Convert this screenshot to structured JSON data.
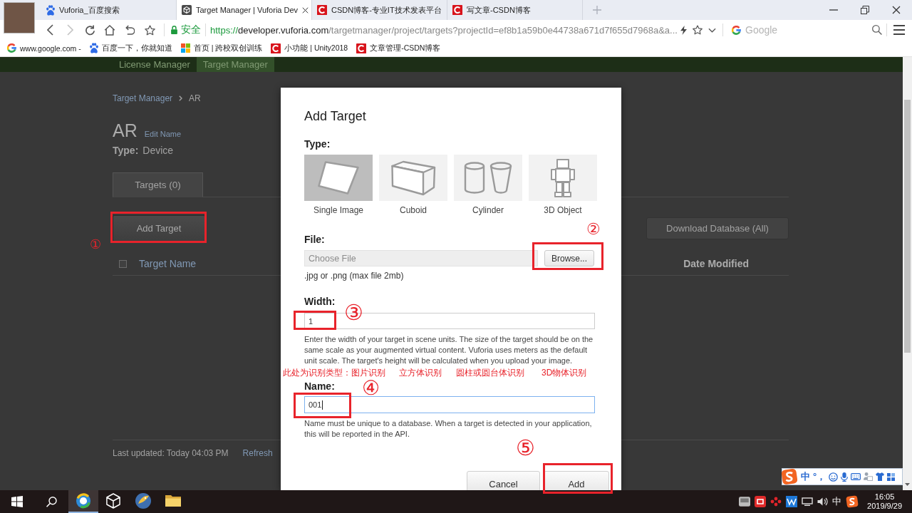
{
  "browser": {
    "tabs": [
      {
        "title": "Vuforia_百度搜索",
        "kind": "paw",
        "selected": false
      },
      {
        "title": "Target Manager | Vuforia Dev",
        "kind": "cube",
        "selected": true
      },
      {
        "title": "CSDN博客-专业IT技术发表平台",
        "kind": "letter-c",
        "selected": false
      },
      {
        "title": "写文章-CSDN博客",
        "kind": "letter-c",
        "selected": false
      }
    ],
    "forward_disabled": true,
    "address": {
      "secure_label": "安全",
      "url_scheme": "https://",
      "url_host": "developer.vuforia.com",
      "url_rest": "/targetmanager/project/targets?projectId=ef8b1a59b0e44738a671d7f655d7968a&a...",
      "search_placeholder": "Google"
    },
    "bookmarks": [
      {
        "label": "www.google.com -",
        "kind": "g"
      },
      {
        "label": "百度一下，你就知道",
        "kind": "paw"
      },
      {
        "label": "首页 | 跨校双创训练",
        "kind": "squares"
      },
      {
        "label": "小功能 | Unity2018",
        "kind": "letter-c"
      },
      {
        "label": "文章管理-CSDN博客",
        "kind": "letter-c"
      }
    ]
  },
  "page": {
    "nav": [
      {
        "label": "License Manager",
        "selected": false
      },
      {
        "label": "Target Manager",
        "selected": true
      }
    ],
    "breadcrumb": [
      "Target Manager",
      "AR"
    ],
    "title": "AR",
    "edit_link": "Edit Name",
    "type_label": "Type:",
    "type_value": "Device",
    "tabs": [
      {
        "label": "Targets (0)",
        "selected": true
      }
    ],
    "add_button": "Add Target",
    "download_button": "Download Database (All)",
    "select_all": {
      "checked": false
    },
    "columns": [
      "Target Name",
      "Date Modified"
    ],
    "last_updated": "Last updated: Today 04:03 PM",
    "refresh_link": "Refresh"
  },
  "dialog": {
    "title": "Add Target",
    "type_label": "Type:",
    "types": [
      {
        "label": "Single Image",
        "kind": "image",
        "selected": true
      },
      {
        "label": "Cuboid",
        "kind": "cuboid",
        "selected": false
      },
      {
        "label": "Cylinder",
        "kind": "cylinder",
        "selected": false
      },
      {
        "label": "3D Object",
        "kind": "object",
        "selected": false
      }
    ],
    "file": {
      "label": "File:",
      "placeholder": "Choose File",
      "button": "Browse...",
      "hint": ".jpg or .png (max file 2mb)"
    },
    "width": {
      "label": "Width:",
      "value": "1",
      "focused": false,
      "hint": "Enter the width of your target in scene units. The size of the target should be on the same scale as your augmented virtual content. Vuforia uses meters as the default unit scale. The target's height will be calculated when you upload your image."
    },
    "name": {
      "label": "Name:",
      "value": "001",
      "focused": true,
      "hint": "Name must be unique to a database. When a target is detected in your application, this will be reported in the API."
    },
    "buttons": [
      "Cancel",
      "Add"
    ]
  },
  "annotations": {
    "steps": [
      "①",
      "②",
      "③",
      "④",
      "⑤"
    ],
    "notes": [
      "此处为识别类型：图片识别",
      "立方体识别",
      "圆柱或圆台体识别",
      "3D物体识别"
    ]
  },
  "ime_bar": {
    "mode": "中",
    "punctuation": "°，"
  },
  "taskbar": {
    "apps": [
      {
        "kind": "ring",
        "active": true
      },
      {
        "kind": "cube",
        "active": false
      },
      {
        "kind": "bird",
        "active": false
      },
      {
        "kind": "folder",
        "active": false
      }
    ],
    "input_indicator": "中",
    "time": "16:05",
    "date": "2019/9/29"
  }
}
